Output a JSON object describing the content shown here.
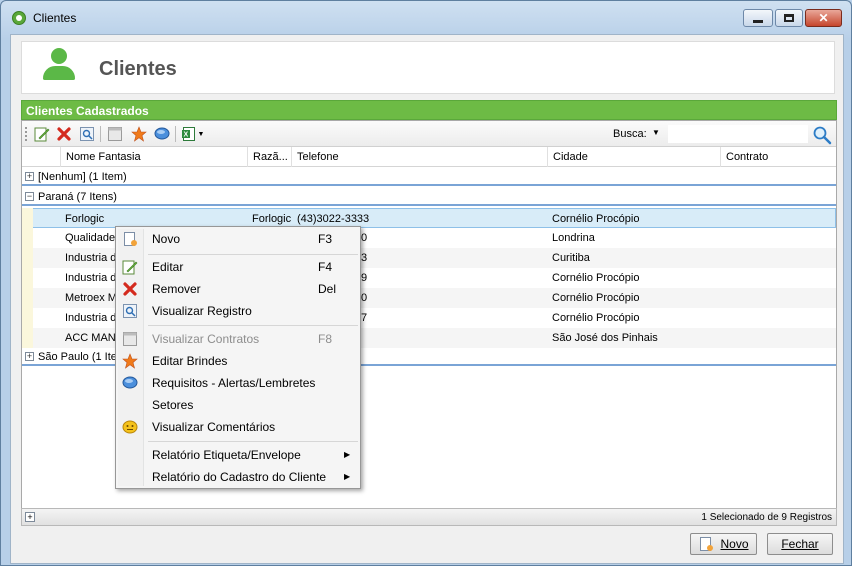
{
  "window": {
    "title": "Clientes",
    "controls": {
      "minimize": "minimize-icon",
      "maximize": "maximize-icon",
      "close": "close-icon"
    }
  },
  "header": {
    "title": "Clientes",
    "icon": "person-icon"
  },
  "panel": {
    "title": "Clientes Cadastrados"
  },
  "toolbar": {
    "icons": [
      "edit-icon",
      "remove-icon",
      "view-record-icon",
      "contracts-icon",
      "gifts-star-icon",
      "comment-bubble-icon",
      "excel-export-icon"
    ],
    "search_label": "Busca:",
    "search_value": ""
  },
  "grid": {
    "columns": [
      "Nome Fantasia",
      "Razã...",
      "Telefone",
      "Cidade",
      "Contrato"
    ],
    "groups": [
      {
        "label": "[Nenhum] (1 Item)",
        "expanded": false
      },
      {
        "label": "Paraná (7 Itens)",
        "expanded": true
      },
      {
        "label": "São Paulo (1 Item)",
        "expanded": false
      }
    ],
    "rows": [
      {
        "nome": "Forlogic",
        "razao": "Forlogic",
        "telefone": "(43)3022-3333",
        "cidade": "Cornélio Procópio",
        "contrato": ""
      },
      {
        "nome": "Qualidade",
        "razao": "",
        "telefone": "0",
        "cidade": "Londrina",
        "contrato": ""
      },
      {
        "nome": "Industria de",
        "razao": "",
        "telefone": "3",
        "cidade": "Curitiba",
        "contrato": ""
      },
      {
        "nome": "Industria de",
        "razao": "",
        "telefone": "9",
        "cidade": "Cornélio Procópio",
        "contrato": ""
      },
      {
        "nome": "Metroex Me",
        "razao": "",
        "telefone": "0",
        "cidade": "Cornélio Procópio",
        "contrato": ""
      },
      {
        "nome": "Industria de",
        "razao": "",
        "telefone": "7",
        "cidade": "Cornélio Procópio",
        "contrato": ""
      },
      {
        "nome": "ACC MANU",
        "razao": "",
        "telefone": "",
        "cidade": "São José dos Pinhais",
        "contrato": ""
      }
    ],
    "footer_status": "1 Selecionado de 9 Registros"
  },
  "context_menu": {
    "items": [
      {
        "label": "Novo",
        "shortcut": "F3",
        "icon": "new-record-icon"
      },
      {
        "label": "Editar",
        "shortcut": "F4",
        "icon": "edit-icon"
      },
      {
        "label": "Remover",
        "shortcut": "Del",
        "icon": "remove-icon"
      },
      {
        "label": "Visualizar Registro",
        "shortcut": "",
        "icon": "view-record-icon"
      },
      {
        "label": "Visualizar Contratos",
        "shortcut": "F8",
        "icon": "contracts-icon",
        "disabled": true
      },
      {
        "label": "Editar Brindes",
        "shortcut": "",
        "icon": "gifts-star-icon"
      },
      {
        "label": "Requisitos - Alertas/Lembretes",
        "shortcut": "",
        "icon": "comment-bubble-icon"
      },
      {
        "label": "Setores",
        "shortcut": "",
        "icon": ""
      },
      {
        "label": "Visualizar Comentários",
        "shortcut": "",
        "icon": "comments-icon"
      },
      {
        "label": "Relatório Etiqueta/Envelope",
        "shortcut": "",
        "submenu": true
      },
      {
        "label": "Relatório do Cadastro do Cliente",
        "shortcut": "",
        "submenu": true
      }
    ]
  },
  "buttons": {
    "novo": "Novo",
    "fechar": "Fechar"
  },
  "colors": {
    "accent_green": "#6dbb45",
    "selection": "#d8ecf8",
    "group_line": "#7aa4d6"
  }
}
